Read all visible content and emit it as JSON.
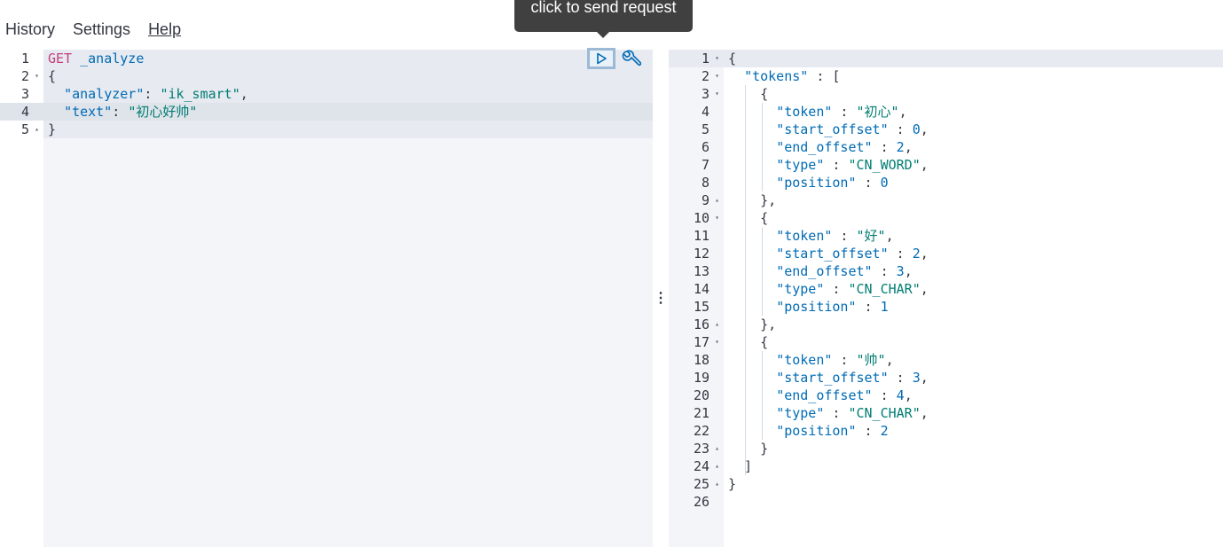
{
  "nav": {
    "history": "History",
    "settings": "Settings",
    "help": "Help"
  },
  "tooltip": "click to send request",
  "icons": {
    "send": "play-icon",
    "settings": "wrench-icon"
  },
  "request": {
    "line_numbers": [
      "1",
      "2",
      "3",
      "4",
      "5"
    ],
    "folds": [
      "",
      "▾",
      "",
      "",
      "▴"
    ],
    "method": "GET",
    "path": "_analyze",
    "open_brace": "{",
    "analyzer_key": "\"analyzer\"",
    "analyzer_val": "\"ik_smart\"",
    "text_key": "\"text\"",
    "text_val": "\"初心好帅\"",
    "close_brace": "}"
  },
  "response": {
    "line_numbers": [
      "1",
      "2",
      "3",
      "4",
      "5",
      "6",
      "7",
      "8",
      "9",
      "10",
      "11",
      "12",
      "13",
      "14",
      "15",
      "16",
      "17",
      "18",
      "19",
      "20",
      "21",
      "22",
      "23",
      "24",
      "25",
      "26"
    ],
    "folds": [
      "▾",
      "▾",
      "▾",
      "",
      "",
      "",
      "",
      "",
      "▴",
      "▾",
      "",
      "",
      "",
      "",
      "",
      "▴",
      "▾",
      "",
      "",
      "",
      "",
      "",
      "▴",
      "▴",
      "▴",
      ""
    ],
    "lines": [
      [
        [
          "p",
          "{"
        ]
      ],
      [
        [
          "p",
          "  "
        ],
        [
          "k",
          "\"tokens\""
        ],
        [
          "p",
          " : ["
        ]
      ],
      [
        [
          "p",
          "    {"
        ]
      ],
      [
        [
          "p",
          "      "
        ],
        [
          "k",
          "\"token\""
        ],
        [
          "p",
          " : "
        ],
        [
          "s",
          "\"初心\""
        ],
        [
          "p",
          ","
        ]
      ],
      [
        [
          "p",
          "      "
        ],
        [
          "k",
          "\"start_offset\""
        ],
        [
          "p",
          " : "
        ],
        [
          "n",
          "0"
        ],
        [
          "p",
          ","
        ]
      ],
      [
        [
          "p",
          "      "
        ],
        [
          "k",
          "\"end_offset\""
        ],
        [
          "p",
          " : "
        ],
        [
          "n",
          "2"
        ],
        [
          "p",
          ","
        ]
      ],
      [
        [
          "p",
          "      "
        ],
        [
          "k",
          "\"type\""
        ],
        [
          "p",
          " : "
        ],
        [
          "s",
          "\"CN_WORD\""
        ],
        [
          "p",
          ","
        ]
      ],
      [
        [
          "p",
          "      "
        ],
        [
          "k",
          "\"position\""
        ],
        [
          "p",
          " : "
        ],
        [
          "n",
          "0"
        ]
      ],
      [
        [
          "p",
          "    },"
        ]
      ],
      [
        [
          "p",
          "    {"
        ]
      ],
      [
        [
          "p",
          "      "
        ],
        [
          "k",
          "\"token\""
        ],
        [
          "p",
          " : "
        ],
        [
          "s",
          "\"好\""
        ],
        [
          "p",
          ","
        ]
      ],
      [
        [
          "p",
          "      "
        ],
        [
          "k",
          "\"start_offset\""
        ],
        [
          "p",
          " : "
        ],
        [
          "n",
          "2"
        ],
        [
          "p",
          ","
        ]
      ],
      [
        [
          "p",
          "      "
        ],
        [
          "k",
          "\"end_offset\""
        ],
        [
          "p",
          " : "
        ],
        [
          "n",
          "3"
        ],
        [
          "p",
          ","
        ]
      ],
      [
        [
          "p",
          "      "
        ],
        [
          "k",
          "\"type\""
        ],
        [
          "p",
          " : "
        ],
        [
          "s",
          "\"CN_CHAR\""
        ],
        [
          "p",
          ","
        ]
      ],
      [
        [
          "p",
          "      "
        ],
        [
          "k",
          "\"position\""
        ],
        [
          "p",
          " : "
        ],
        [
          "n",
          "1"
        ]
      ],
      [
        [
          "p",
          "    },"
        ]
      ],
      [
        [
          "p",
          "    {"
        ]
      ],
      [
        [
          "p",
          "      "
        ],
        [
          "k",
          "\"token\""
        ],
        [
          "p",
          " : "
        ],
        [
          "s",
          "\"帅\""
        ],
        [
          "p",
          ","
        ]
      ],
      [
        [
          "p",
          "      "
        ],
        [
          "k",
          "\"start_offset\""
        ],
        [
          "p",
          " : "
        ],
        [
          "n",
          "3"
        ],
        [
          "p",
          ","
        ]
      ],
      [
        [
          "p",
          "      "
        ],
        [
          "k",
          "\"end_offset\""
        ],
        [
          "p",
          " : "
        ],
        [
          "n",
          "4"
        ],
        [
          "p",
          ","
        ]
      ],
      [
        [
          "p",
          "      "
        ],
        [
          "k",
          "\"type\""
        ],
        [
          "p",
          " : "
        ],
        [
          "s",
          "\"CN_CHAR\""
        ],
        [
          "p",
          ","
        ]
      ],
      [
        [
          "p",
          "      "
        ],
        [
          "k",
          "\"position\""
        ],
        [
          "p",
          " : "
        ],
        [
          "n",
          "2"
        ]
      ],
      [
        [
          "p",
          "    }"
        ]
      ],
      [
        [
          "p",
          "  ]"
        ]
      ],
      [
        [
          "p",
          "}"
        ]
      ],
      [
        [
          "p",
          ""
        ]
      ]
    ]
  },
  "resizer": "⋮"
}
